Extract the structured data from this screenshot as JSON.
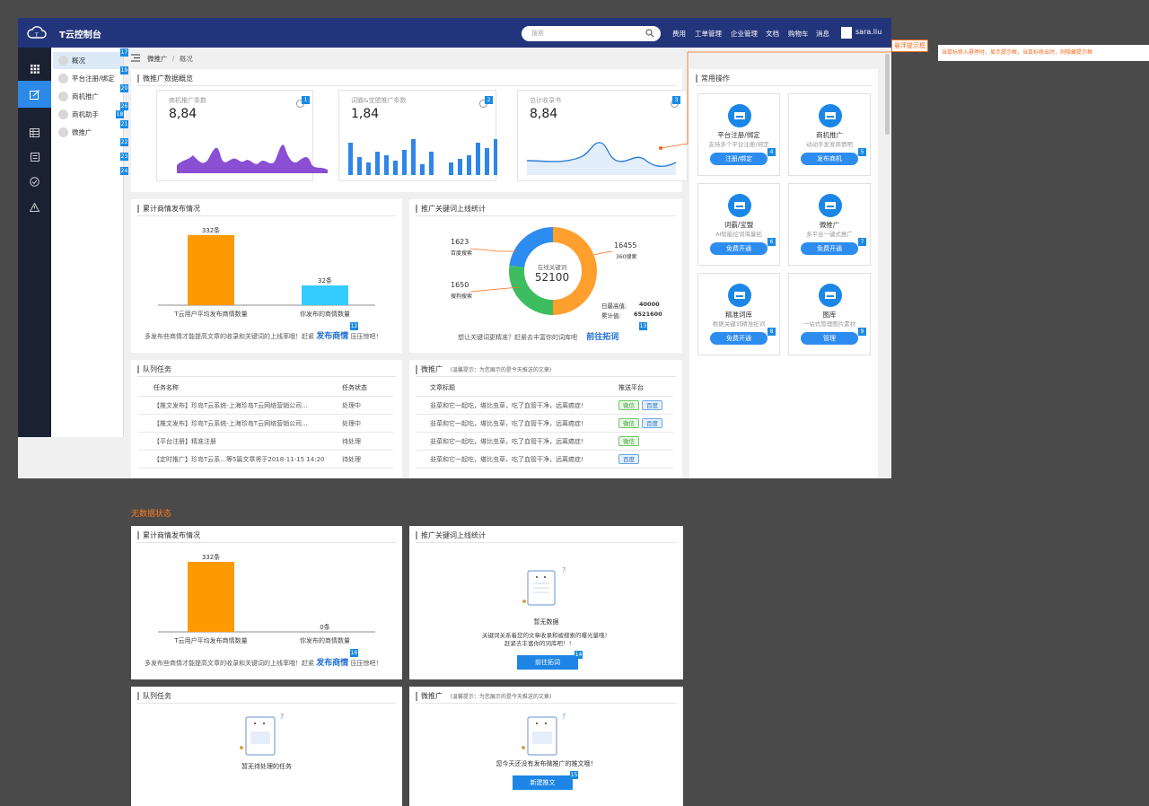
{
  "app": {
    "title": "T云控制台",
    "search_placeholder": "搜索",
    "nav": [
      "费用",
      "工单管理",
      "企业管理",
      "文档",
      "购物车",
      "消息"
    ],
    "user": "sara.liu"
  },
  "subnav": [
    {
      "label": "概况",
      "num": "17"
    },
    {
      "label": "平台注册/绑定",
      "num": "19"
    },
    {
      "label": "商机推广",
      "num": "20"
    },
    {
      "label": "商机助手",
      "num": "18"
    },
    {
      "label": "微推广",
      "num": "21"
    }
  ],
  "subnav_extra_nums": [
    "22",
    "23",
    "24"
  ],
  "subnav_side_nums": [
    "26"
  ],
  "breadcrumb": {
    "a": "微推广",
    "sep": "/",
    "b": "概况"
  },
  "tooltip": {
    "tag": "悬浮提示框",
    "text": "当鼠标移入悬停时，显示提示框，当鼠标移出时，则隐藏提示框"
  },
  "overview": {
    "title": "微推广数据概览",
    "stats": [
      {
        "label": "商机推广条数",
        "value": "8,84",
        "num": "1"
      },
      {
        "label": "词霸&宝盟推广条数",
        "value": "1,84",
        "num": "2"
      },
      {
        "label": "总计收录书",
        "value": "8,84",
        "num": "3"
      }
    ]
  },
  "bar_card": {
    "title": "累计商情发布情况",
    "footer": "多发布些商情才能提高文章的收录和关键词的上线率哦！赶紧",
    "link": "发布商情",
    "footer2": "压压惊吧！",
    "num": "12"
  },
  "donut_card": {
    "title": "推广关键词上线统计",
    "center_label": "在线关键词",
    "center_value": "52100",
    "baidu_value": "1623",
    "baidu_label": "百度搜索",
    "s360_value": "16455",
    "s360_label": "360搜索",
    "sogou_value": "1650",
    "sogou_label": "搜狗搜索",
    "daily_label": "日最高值:",
    "daily_value": "40000",
    "total_label": "累计值:",
    "total_value": "6521600",
    "footer": "想让关键词更精准？赶紧去丰富你的词库吧",
    "link": "前往拓词",
    "num": "13"
  },
  "chart_data": [
    {
      "type": "bar",
      "title": "累计商情发布情况",
      "categories": [
        "T云用户平均发布商情数量",
        "你发布的商情数量"
      ],
      "values": [
        332
      ],
      "data_labels": [
        "332条",
        "32条"
      ],
      "colors": [
        "#ff9900",
        "#33ccff"
      ]
    },
    {
      "type": "pie",
      "title": "推广关键词上线统计",
      "categories": [
        "百度搜索",
        "360搜索",
        "搜狗搜索"
      ],
      "values": [
        1623,
        16455,
        1650
      ],
      "colors": [
        "#ff9f2e",
        "#3dbd5f",
        "#2d8cf0"
      ]
    },
    {
      "type": "bar",
      "title": "累计商情发布情况",
      "categories": [
        "T云用户平均发布商情数量",
        "你发布的商情数量"
      ],
      "values": [
        332,
        0
      ],
      "data_labels": [
        "332条",
        "0条"
      ],
      "colors": [
        "#ff9900",
        "#33ccff"
      ]
    }
  ],
  "quick": {
    "title": "常用操作",
    "items": [
      {
        "title": "平台注册/绑定",
        "sub": "支持多个平台注册/绑定",
        "btn": "注册/绑定",
        "num": "4"
      },
      {
        "title": "商机推广",
        "sub": "动动手发发商情吧",
        "btn": "发布商机",
        "num": "5"
      },
      {
        "title": "词霸/宝盟",
        "sub": "AI智能挖词海量拓",
        "btn": "免费开通",
        "num": "6"
      },
      {
        "title": "微推广",
        "sub": "多平台一键式推广",
        "btn": "免费开通",
        "num": "7"
      },
      {
        "title": "精准词库",
        "sub": "根据关键词精准拓词",
        "btn": "免费开通",
        "num": "8"
      },
      {
        "title": "图库",
        "sub": "一站式管理图片素材",
        "btn": "管理",
        "num": "9"
      }
    ]
  },
  "tasks": {
    "title": "队列任务",
    "col1": "任务名称",
    "col2": "任务状态",
    "rows": [
      [
        "【推文发布】珍岛T云系统-上海珍岛T云网络营销公司...",
        "处理中"
      ],
      [
        "【推文发布】珍岛T云系统-上海珍岛T云网络营销公司...",
        "处理中"
      ],
      [
        "【平台注册】精准注册",
        "待处理"
      ],
      [
        "【定时推广】珍岛T云系...等5篇文章将于2018-11-15 14:20",
        "待处理"
      ]
    ]
  },
  "weitg": {
    "title": "微推广",
    "hint": "(温馨提示：为您展示的是今天推送的文章)",
    "col1": "文章标题",
    "col2": "推送平台",
    "rows": [
      {
        "t": "韭菜和它一起吃，堪比虫草，吃了血管干净，远离癌症!",
        "p": [
          "微信",
          "百度"
        ]
      },
      {
        "t": "韭菜和它一起吃，堪比虫草，吃了血管干净，远离癌症!",
        "p": [
          "微信",
          "百度"
        ]
      },
      {
        "t": "韭菜和它一起吃，堪比虫草，吃了血管干净，远离癌症!",
        "p": [
          "微信"
        ]
      },
      {
        "t": "韭菜和它一起吃，堪比虫草，吃了血管干净，远离癌症!",
        "p": [
          "百度"
        ]
      }
    ]
  },
  "empty": {
    "section_label": "无数据状态",
    "bar_num": "16",
    "nodata": "暂无数据",
    "kw_text1": "关键词关系着您的文章收录和被搜索的曝光量哦！",
    "kw_text2": "赶紧去丰富你的词库吧！！",
    "kw_btn": "前往拓词",
    "kw_num": "14",
    "task_text": "暂无待处理的任务",
    "wt_text": "您今天还没有发布微推广的推文哦！",
    "wt_btn": "新建推文",
    "wt_num": "15"
  }
}
